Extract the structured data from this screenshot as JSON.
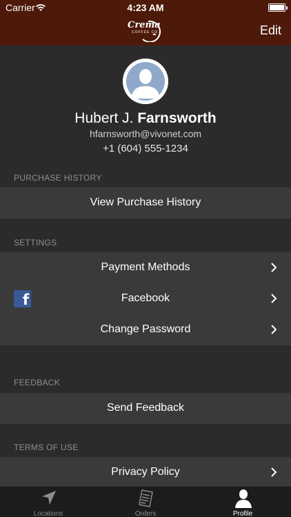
{
  "status_bar": {
    "carrier": "Carrier",
    "time": "4:23 AM"
  },
  "nav": {
    "brand": "Crema",
    "brand_sub": "COFFEE CO.",
    "edit_label": "Edit",
    "color": "#4d1a0a"
  },
  "profile": {
    "first_name": "Hubert J.",
    "last_name": "Farnsworth",
    "email": "hfarnsworth@vivonet.com",
    "phone": "+1 (604) 555-1234"
  },
  "sections": {
    "purchase_history": {
      "header": "PURCHASE HISTORY",
      "items": [
        {
          "label": "View Purchase History"
        }
      ]
    },
    "settings": {
      "header": "SETTINGS",
      "items": [
        {
          "label": "Payment Methods",
          "icon": "chevron-right-icon"
        },
        {
          "label": "Facebook",
          "icon": "facebook-icon"
        },
        {
          "label": "Change Password",
          "icon": "chevron-right-icon"
        }
      ]
    },
    "feedback": {
      "header": "FEEDBACK",
      "items": [
        {
          "label": "Send Feedback"
        }
      ]
    },
    "terms": {
      "header": "TERMS OF USE",
      "items": [
        {
          "label": "Privacy Policy",
          "icon": "chevron-right-icon"
        }
      ]
    }
  },
  "tabbar": {
    "tabs": [
      {
        "label": "Locations",
        "icon": "location-arrow-icon",
        "active": false
      },
      {
        "label": "Orders",
        "icon": "receipt-icon",
        "active": false
      },
      {
        "label": "Profile",
        "icon": "person-icon",
        "active": true
      }
    ]
  }
}
